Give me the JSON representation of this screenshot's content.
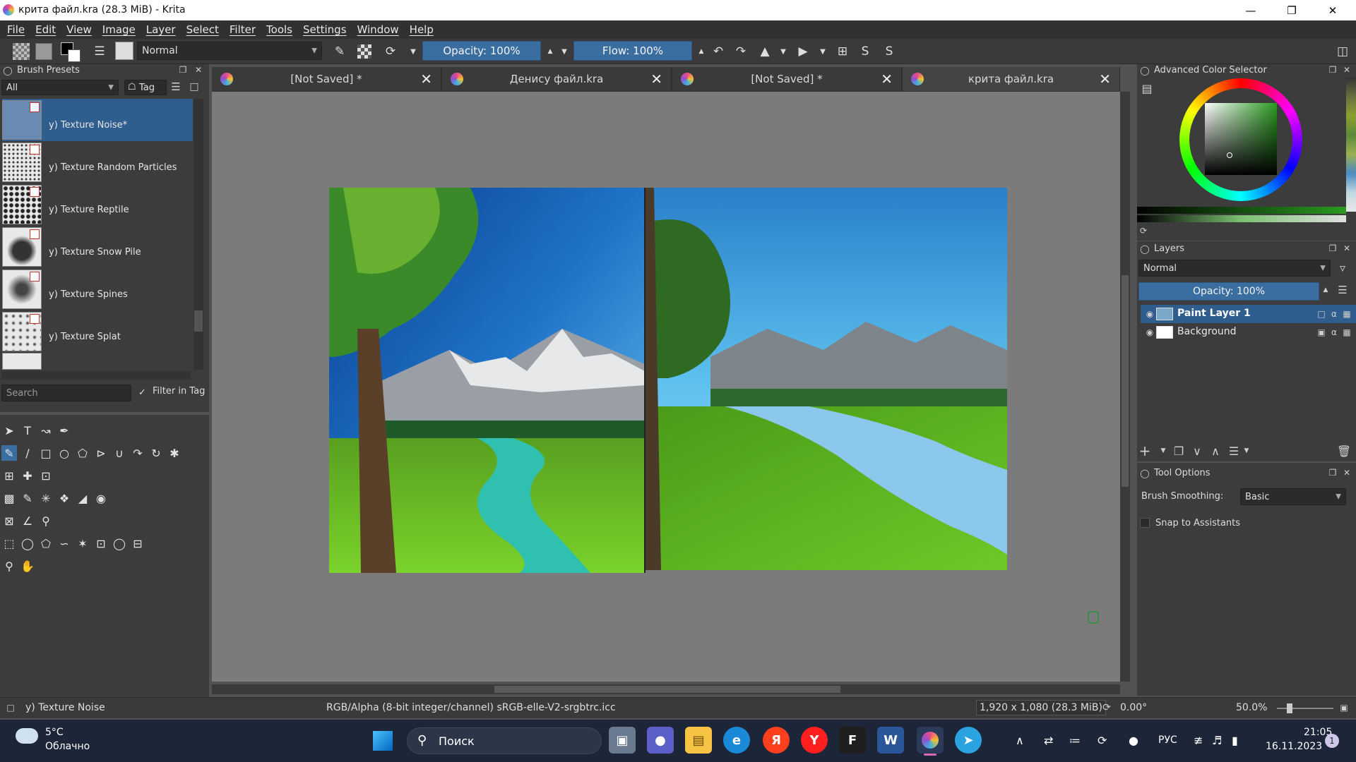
{
  "window": {
    "title": "крита файл.kra (28.3 MiB)  - Krita"
  },
  "menu": [
    "File",
    "Edit",
    "View",
    "Image",
    "Layer",
    "Select",
    "Filter",
    "Tools",
    "Settings",
    "Window",
    "Help"
  ],
  "toolbar": {
    "blend_mode": "Normal",
    "opacity": "Opacity: 100%",
    "flow": "Flow: 100%"
  },
  "brush_presets": {
    "title": "Brush Presets",
    "filter": "All",
    "tag": "Tag",
    "items": [
      "y) Texture Noise*",
      "y) Texture Random Particles",
      "y) Texture Reptile",
      "y) Texture Snow Pile",
      "y) Texture Spines",
      "y) Texture Splat"
    ],
    "search_placeholder": "Search",
    "filter_in_tag": "Filter in Tag"
  },
  "tabs": [
    {
      "label": "[Not Saved]  *"
    },
    {
      "label": "Денису файл.kra"
    },
    {
      "label": "[Not Saved]  *"
    },
    {
      "label": "крита файл.kra"
    }
  ],
  "color_selector": {
    "title": "Advanced Color Selector"
  },
  "layers": {
    "title": "Layers",
    "blend_mode": "Normal",
    "opacity": "Opacity:  100%",
    "items": [
      {
        "name": "Paint Layer 1"
      },
      {
        "name": "Background"
      }
    ]
  },
  "tool_options": {
    "title": "Tool Options",
    "brush_smoothing_label": "Brush Smoothing:",
    "brush_smoothing_value": "Basic",
    "snap_label": "Snap to Assistants"
  },
  "status": {
    "brush": "y) Texture Noise",
    "color_space": "RGB/Alpha (8-bit integer/channel)  sRGB-elle-V2-srgbtrc.icc",
    "dimensions": "1,920 x 1,080 (28.3 MiB)",
    "rotation": "0.00°",
    "zoom": "50.0%"
  },
  "taskbar": {
    "weather_temp": "5°C",
    "weather_desc": "Облачно",
    "search_placeholder": "Поиск",
    "lang": "РУС",
    "time": "21:05",
    "date": "16.11.2023",
    "notif_count": "1"
  }
}
